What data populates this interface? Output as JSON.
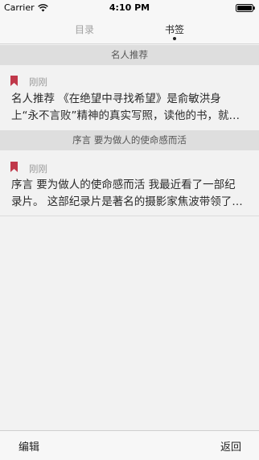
{
  "status_bar": {
    "carrier": "Carrier",
    "time": "4:10 PM"
  },
  "tabs": [
    {
      "label": "目录",
      "active": false
    },
    {
      "label": "书签",
      "active": true
    }
  ],
  "bookmarks": [
    {
      "section": "名人推荐",
      "time": "刚刚",
      "text_line1": "名人推荐 《在绝望中寻找希望》是俞敏洪身",
      "text_line2": "上“永不言败”精神的真实写照，读他的书，就…"
    },
    {
      "section": "序言  要为做人的使命感而活",
      "time": "刚刚",
      "text_line1": "序言 要为做人的使命感而活 我最近看了一部纪",
      "text_line2": "录片。 这部纪录片是著名的摄影家焦波带领了…"
    }
  ],
  "bottom_bar": {
    "edit_label": "编辑",
    "back_label": "返回"
  },
  "colors": {
    "bookmark_flag": "#c0384a",
    "section_bg": "#dedede",
    "background": "#f2f2f2"
  }
}
